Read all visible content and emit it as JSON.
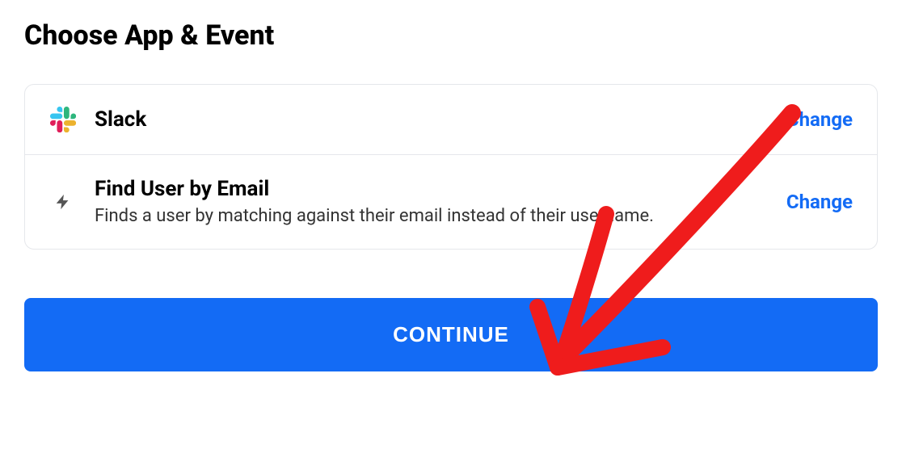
{
  "heading": "Choose App & Event",
  "rows": {
    "app": {
      "title": "Slack",
      "changeLabel": "Change"
    },
    "event": {
      "title": "Find User by Email",
      "description": "Finds a user by matching against their email instead of their username.",
      "changeLabel": "Change"
    }
  },
  "continueLabel": "CONTINUE"
}
